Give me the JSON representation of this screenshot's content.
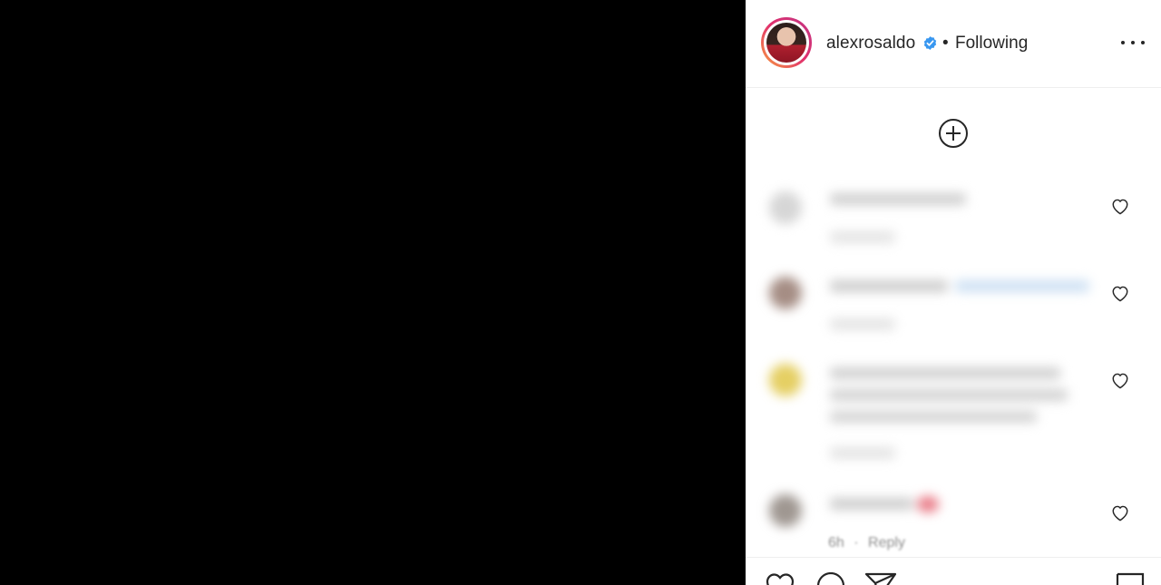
{
  "post": {
    "username": "alexrosaldo",
    "separator": "•",
    "follow_status": "Following"
  },
  "comments_partial_meta": {
    "time": "6h",
    "reply_label": "Reply"
  },
  "colors": {
    "text": "#262626",
    "muted": "#8e8e8e",
    "verified_blue": "#3897f0",
    "border": "#efefef",
    "media_background": "#000000"
  },
  "icons": {
    "more": "more-options-icon",
    "load_more": "plus-circle-icon",
    "like": "heart-icon",
    "comment": "comment-icon",
    "share": "paper-plane-icon",
    "save": "bookmark-icon",
    "verified": "verified-badge-icon"
  }
}
